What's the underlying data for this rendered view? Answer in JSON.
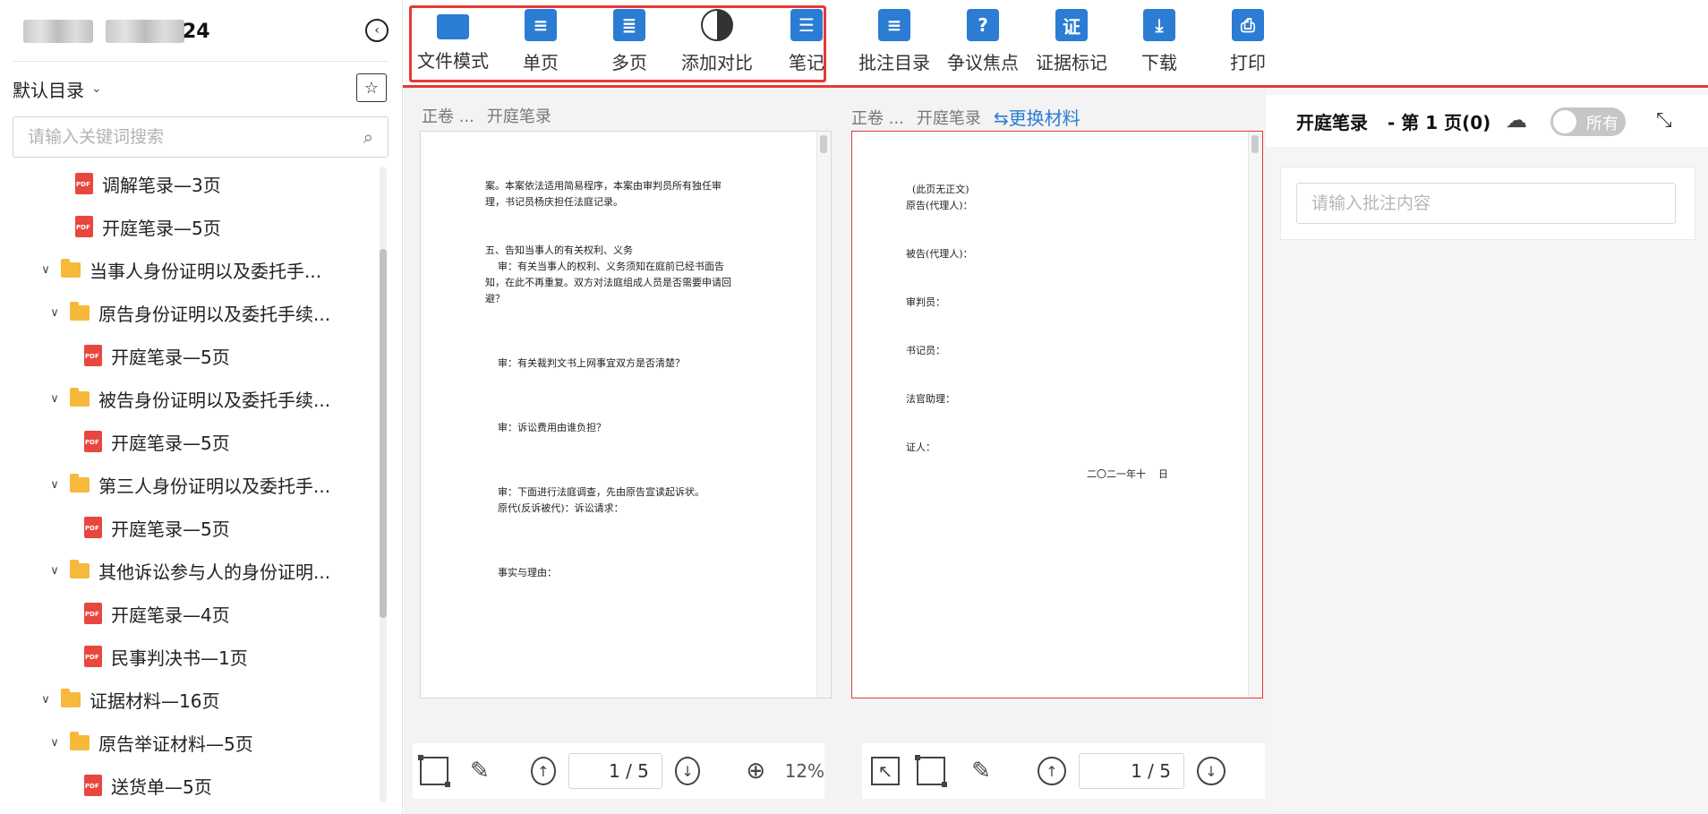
{
  "sidebar": {
    "case_suffix": "24",
    "collapse_icon": "‹",
    "directory_label": "默认目录",
    "chevron": "⌄",
    "fav_icon": "☆",
    "search_placeholder": "请输入关键词搜索",
    "search_icon": "⌕",
    "tree": [
      {
        "type": "pdf",
        "label": "调解笔录—3页",
        "indent": 1,
        "selected": false
      },
      {
        "type": "pdf",
        "label": "开庭笔录—5页",
        "indent": 1,
        "selected": false
      },
      {
        "type": "folder",
        "label": "当事人身份证明以及委托手...",
        "indent": 0,
        "selected": false
      },
      {
        "type": "folder",
        "label": "原告身份证明以及委托手续...",
        "indent": 1,
        "selected": false
      },
      {
        "type": "pdf",
        "label": "开庭笔录—5页",
        "indent": 2,
        "selected": true
      },
      {
        "type": "folder",
        "label": "被告身份证明以及委托手续...",
        "indent": 1,
        "selected": false
      },
      {
        "type": "pdf",
        "label": "开庭笔录—5页",
        "indent": 2,
        "selected": false
      },
      {
        "type": "folder",
        "label": "第三人身份证明以及委托手...",
        "indent": 1,
        "selected": false
      },
      {
        "type": "pdf",
        "label": "开庭笔录—5页",
        "indent": 2,
        "selected": false
      },
      {
        "type": "folder",
        "label": "其他诉讼参与人的身份证明...",
        "indent": 1,
        "selected": false
      },
      {
        "type": "pdf",
        "label": "开庭笔录—4页",
        "indent": 2,
        "selected": false
      },
      {
        "type": "pdf",
        "label": "民事判决书—1页",
        "indent": 2,
        "selected": false
      },
      {
        "type": "folder",
        "label": "证据材料—16页",
        "indent": 0,
        "selected": false
      },
      {
        "type": "folder",
        "label": "原告举证材料—5页",
        "indent": 1,
        "selected": false
      },
      {
        "type": "pdf",
        "label": "送货单—5页",
        "indent": 2,
        "selected": false
      }
    ]
  },
  "toolbar": {
    "tools": [
      {
        "name": "file-mode",
        "label": "文件模式",
        "icon": "folder-icon",
        "glyph": ""
      },
      {
        "name": "single-page",
        "label": "单页",
        "icon": "single-page-icon",
        "glyph": "≡"
      },
      {
        "name": "multi-page",
        "label": "多页",
        "icon": "multi-page-icon",
        "glyph": "≣"
      },
      {
        "name": "compare",
        "label": "添加对比",
        "icon": "compare-icon",
        "glyph": ""
      },
      {
        "name": "notes",
        "label": "笔记",
        "icon": "notes-icon",
        "glyph": "☰"
      },
      {
        "name": "annotation-index",
        "label": "批注目录",
        "icon": "comment-icon",
        "glyph": "≡"
      },
      {
        "name": "dispute-focus",
        "label": "争议焦点",
        "icon": "question-icon",
        "glyph": "?"
      },
      {
        "name": "evidence-mark",
        "label": "证据标记",
        "icon": "shield-icon",
        "glyph": "证"
      },
      {
        "name": "download",
        "label": "下载",
        "icon": "download-icon",
        "glyph": "⤓"
      },
      {
        "name": "print",
        "label": "打印",
        "icon": "printer-icon",
        "glyph": "⎙"
      }
    ]
  },
  "left_doc": {
    "crumb_volume": "正卷 ...",
    "crumb_doc": "开庭笔录",
    "text": "案。本案依法适用简易程序，本案由审判员所有独任审\n理，书记员杨庆担任法庭记录。\n\n\n五、告知当事人的有关权利、义务\n    审：有关当事人的权利、义务须知在庭前已经书面告\n知，在此不再重复。双方对法庭组成人员是否需要申请回\n避？\n\n\n\n    审：有关裁判文书上网事宜双方是否清楚？\n\n\n\n    审：诉讼费用由谁负担？\n\n\n\n    审：下面进行法庭调查，先由原告宣读起诉状。\n    原代(反诉被代)：诉讼请求：\n\n\n\n    事实与理由：",
    "page_value": "1 / 5",
    "zoom": "12%"
  },
  "right_doc": {
    "crumb_volume": "正卷 ...",
    "crumb_doc": "开庭笔录",
    "swap_label": "⇆更换材料",
    "text": "  (此页无正文)\n原告(代理人)：\n\n\n被告(代理人)：\n\n\n审判员：\n\n\n书记员：\n\n\n法官助理：\n\n\n证人：",
    "date_text": "二〇二一年十    日",
    "page_value": "1 / 5"
  },
  "panel": {
    "title": "开庭笔录",
    "subtitle": "- 第 1 页(0)",
    "toggle_label": "所有",
    "shrink_icon": "⤡",
    "cloud_icon": "☁",
    "annotation_placeholder": "请输入批注内容"
  },
  "controls": {
    "rect_select_icon": "▢",
    "pen_icon": "✎",
    "up_icon": "↑",
    "down_icon": "↓",
    "zoom_in_icon": "⊕",
    "pointer_icon": "↖"
  }
}
